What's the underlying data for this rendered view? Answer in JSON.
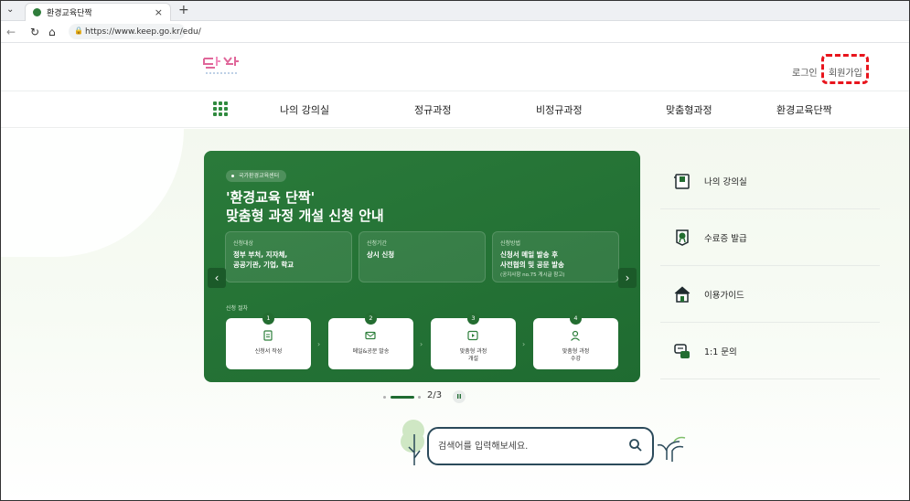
{
  "browser": {
    "tab_title": "환경교육단짝",
    "url": "https://www.keep.go.kr/edu/"
  },
  "header": {
    "login": "로그인",
    "signup": "회원가입"
  },
  "gnb": {
    "items": [
      "나의 강의실",
      "정규과정",
      "비정규과정",
      "맞춤형과정",
      "환경교육단짝"
    ]
  },
  "banner": {
    "badge": "국가환경교육센터",
    "title_line1": "'환경교육 단짝'",
    "title_line2": "맞춤형 과정 개설 신청 안내",
    "info": [
      {
        "label": "신청대상",
        "value": "정부 부처, 지자체,\n공공기관, 기업, 학교",
        "note": ""
      },
      {
        "label": "신청기간",
        "value": "상시 신청",
        "note": ""
      },
      {
        "label": "신청방법",
        "value": "신청서 메일 발송 후\n사전협의 및 공문 발송",
        "note": "(공지사항 no.75 게시글 참고)"
      }
    ],
    "process_label": "신청 절차",
    "steps": [
      {
        "num": "1",
        "label": "신청서 작성",
        "icon": "document-icon"
      },
      {
        "num": "2",
        "label": "메일&공문 발송",
        "icon": "mail-icon"
      },
      {
        "num": "3",
        "label": "맞춤형 과정\n개설",
        "icon": "play-icon"
      },
      {
        "num": "4",
        "label": "맞춤형 과정\n수강",
        "icon": "person-icon"
      }
    ]
  },
  "pager": {
    "current": "2/3",
    "progress": 0.67
  },
  "quick_menu": {
    "items": [
      {
        "label": "나의 강의실",
        "icon": "classroom-icon"
      },
      {
        "label": "수료증 발급",
        "icon": "certificate-icon"
      },
      {
        "label": "이용가이드",
        "icon": "guide-house-icon"
      },
      {
        "label": "1:1 문의",
        "icon": "inquiry-icon"
      }
    ]
  },
  "search": {
    "placeholder": "검색어를 입력해보세요."
  },
  "colors": {
    "brand_green": "#236d31",
    "highlight_red": "#e8141c"
  }
}
